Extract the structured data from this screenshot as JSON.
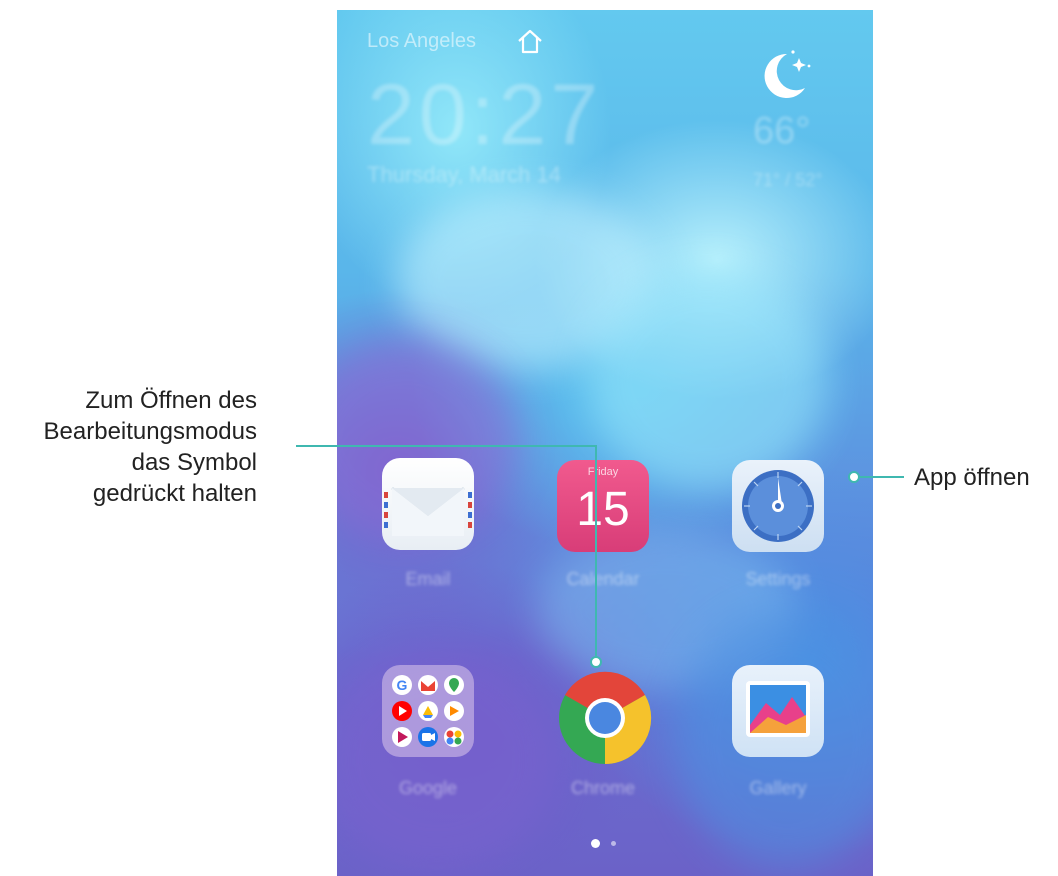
{
  "status": {
    "city": "Los Angeles",
    "time": "20:27",
    "date": "Thursday, March 14",
    "temperature": "66°",
    "temp_range": "71° / 52°"
  },
  "apps": [
    {
      "label": "Email",
      "icon": "email-icon"
    },
    {
      "label": "Calendar",
      "icon": "calendar-icon",
      "day_name": "Friday",
      "day_number": "15"
    },
    {
      "label": "Settings",
      "icon": "settings-icon"
    },
    {
      "label": "Google",
      "icon": "google-folder-icon"
    },
    {
      "label": "Chrome",
      "icon": "chrome-icon"
    },
    {
      "label": "Gallery",
      "icon": "gallery-icon"
    }
  ],
  "page_indicator": {
    "current": 1,
    "total": 2
  },
  "annotations": {
    "open_app": "App öffnen",
    "edit_mode_lines": [
      "Zum Öffnen des",
      "Bearbeitungsmodus",
      "das Symbol",
      "gedrückt halten"
    ]
  },
  "colors": {
    "callout_line": "#3fb8b0",
    "calendar_pink": "#e84e86",
    "chrome_red": "#e3453a",
    "chrome_yellow": "#f5c22c",
    "chrome_green": "#34a853",
    "chrome_blue": "#4a87e0"
  }
}
